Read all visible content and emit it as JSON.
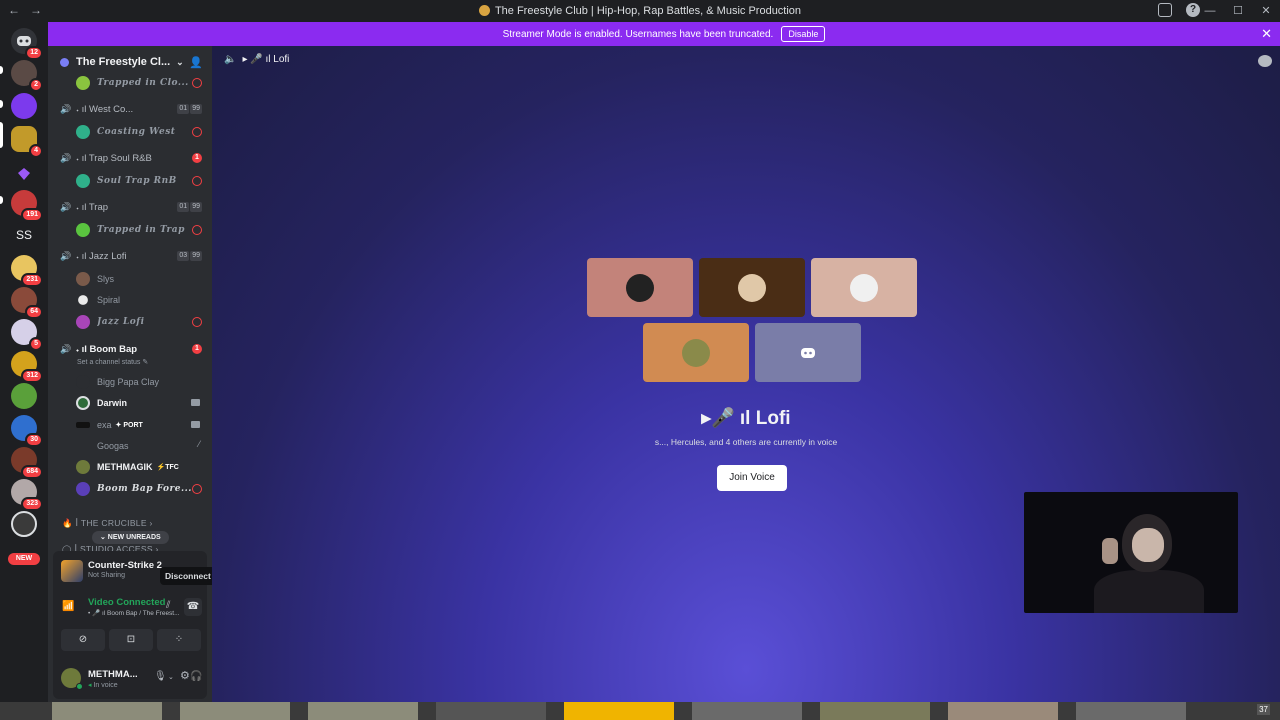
{
  "window": {
    "title": "The Freestyle Club | Hip-Hop, Rap Battles, & Music Production",
    "nav_back": "←",
    "nav_forward": "→",
    "minimize": "—",
    "maximize": "☐",
    "close": "✕"
  },
  "banner": {
    "text": "Streamer Mode is enabled. Usernames have been truncated.",
    "button": "Disable",
    "close": "✕"
  },
  "rail": {
    "home_badge": "12",
    "badges": [
      "2",
      "4",
      "191",
      "231",
      "64",
      "5",
      "312",
      "30",
      "684",
      "323"
    ],
    "text_guild": "SS",
    "new_label": "NEW"
  },
  "server": {
    "name": "The Freestyle Cl...",
    "chevron": "⌄"
  },
  "channels": [
    {
      "name": "𝆺 ıl West Co...",
      "counts": [
        "01",
        "99"
      ]
    },
    {
      "name": "𝆺 ıl Trap Soul R&B",
      "badge": "1"
    },
    {
      "name": "𝆺 ıl Trap",
      "counts": [
        "01",
        "99"
      ]
    },
    {
      "name": "𝆺 ıl Jazz Lofi",
      "counts": [
        "03",
        "99"
      ]
    },
    {
      "name": "𝆺 ıl Boom Bap",
      "badge": "1"
    }
  ],
  "members": {
    "trapped_clo": "Trapped in Clo...",
    "coasting_west": "Coasting West",
    "soul_trap": "Soul Trap RnB",
    "trapped_trap": "Trapped in Trap",
    "slys": "Slys",
    "spiral": "Spiral",
    "jazz_lofi": "Jazz Lofi",
    "bigg": "Bigg Papa Clay",
    "darwin": "Darwin",
    "exa": "exa",
    "exa_tag": "✦ PORT",
    "googas": "Googas",
    "meth": "METHMAGIK",
    "meth_tag": "⚡TFC",
    "boombap": "Boom Bap Fore..."
  },
  "channel_status": "Set a channel status ✎",
  "categories": {
    "crucible": "🔥 ꟾ THE CRUCIBLE ›",
    "studio": "◯ ꟾ STUDIO ACCESS ›"
  },
  "new_unreads": "⌄ NEW UNREADS",
  "activity": {
    "game": "Counter-Strike 2",
    "sub": "Not Sharing"
  },
  "tooltip": "Disconnect",
  "voice": {
    "status": "Video Connected",
    "location": "• 🎤 ıl Boom Bap / The Freest..."
  },
  "user": {
    "name": "METHMA...",
    "status": "In voice"
  },
  "main": {
    "header": "▸ 🎤 ıl Lofi",
    "title": "▸🎤 ıl Lofi",
    "sub": "s..., Hercules, and 4 others are currently in voice",
    "join": "Join Voice"
  },
  "taskbar": {
    "count": "37"
  },
  "colors": {
    "accent": "#8b2bf0",
    "online": "#23a55a",
    "danger": "#f23f43",
    "blurple": "#5865f2"
  }
}
